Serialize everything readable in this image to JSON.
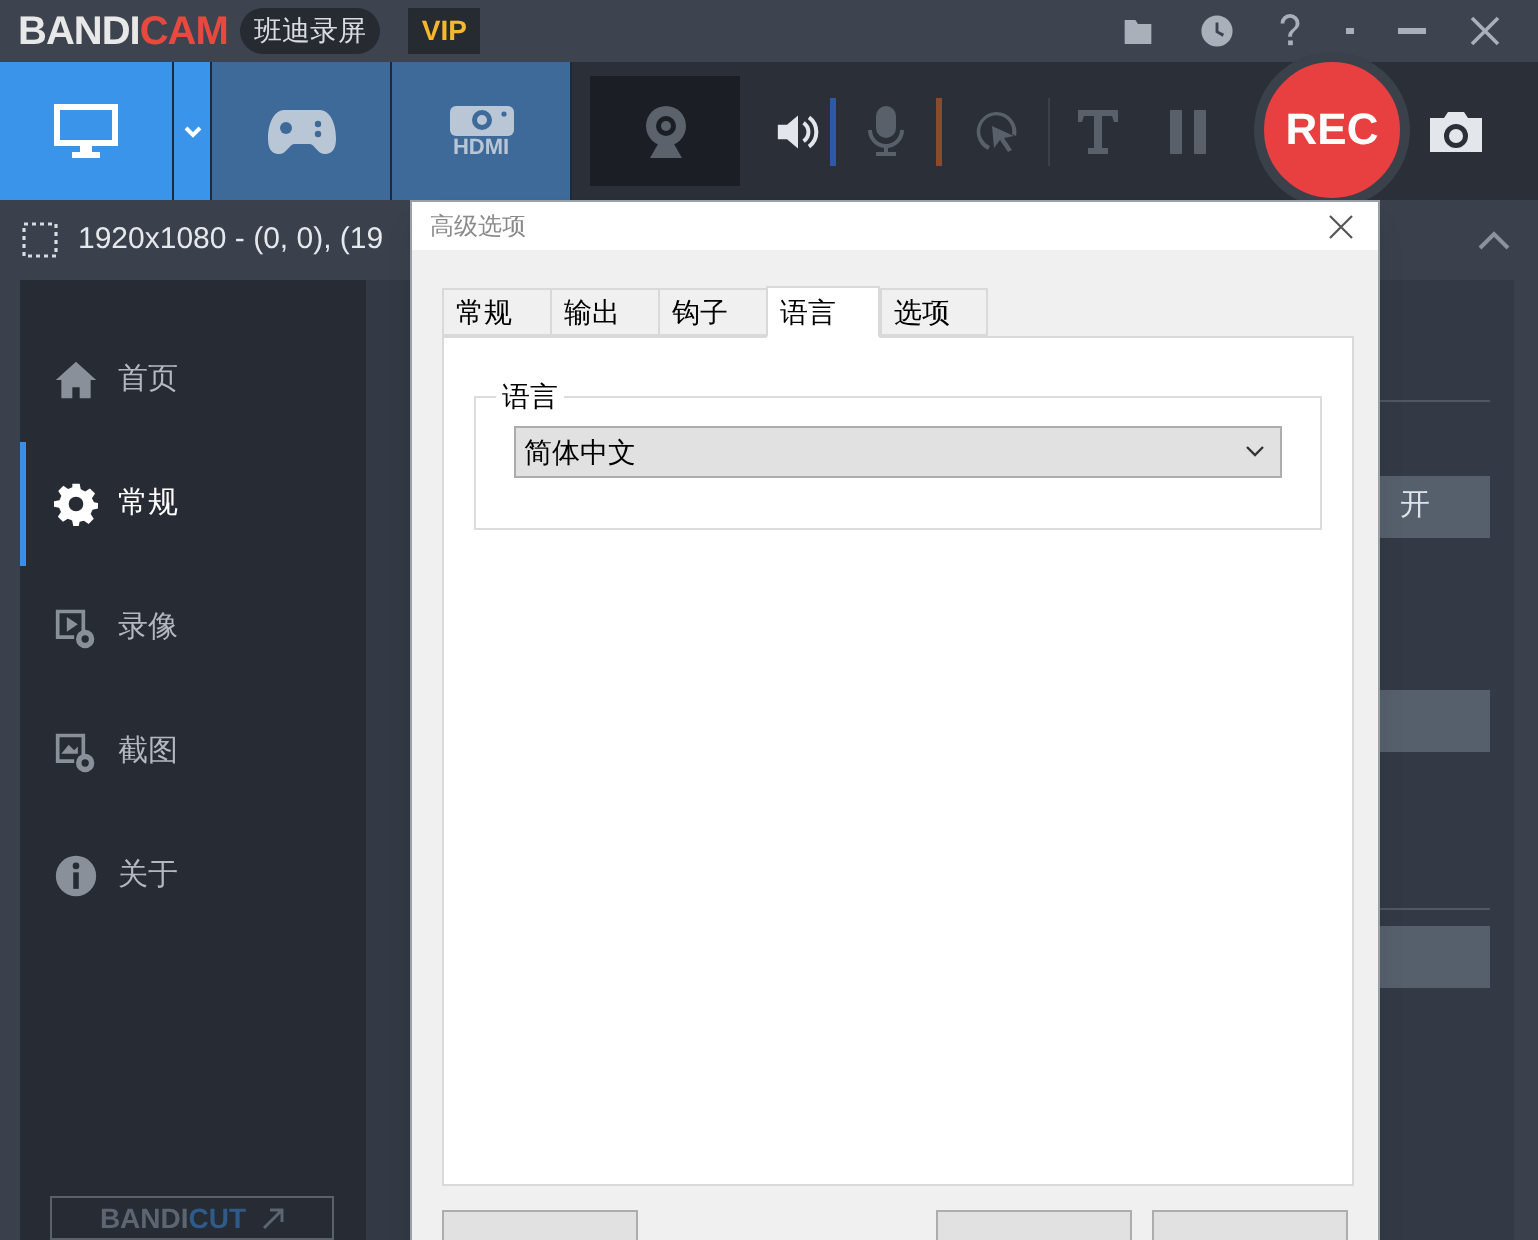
{
  "app": {
    "logo_main": "BANDI",
    "logo_accent": "CAM",
    "edition": "班迪录屏",
    "badge": "VIP"
  },
  "modes": [
    {
      "kind": "screen",
      "selected": true
    },
    {
      "kind": "game",
      "selected": false
    },
    {
      "kind": "hdmi",
      "caption": "HDMI",
      "selected": false
    }
  ],
  "rec_button": "REC",
  "region": "1920x1080 - (0, 0), (19",
  "sidebar": {
    "items": [
      {
        "kind": "home",
        "label": "首页",
        "selected": false
      },
      {
        "kind": "gear",
        "label": "常规",
        "selected": true
      },
      {
        "kind": "video",
        "label": "录像",
        "selected": false
      },
      {
        "kind": "image",
        "label": "截图",
        "selected": false
      },
      {
        "kind": "info",
        "label": "关于",
        "selected": false
      }
    ],
    "footer": {
      "main": "BANDI",
      "accent": "CUT"
    }
  },
  "background_panel": {
    "button_text": "开"
  },
  "dialog": {
    "title": "高级选项",
    "tabs": [
      {
        "label": "常规",
        "selected": false
      },
      {
        "label": "输出",
        "selected": false
      },
      {
        "label": "钩子",
        "selected": false
      },
      {
        "label": "语言",
        "selected": true
      },
      {
        "label": "选项",
        "selected": false
      }
    ],
    "group": {
      "label": "语言",
      "select": {
        "value": "简体中文"
      }
    }
  }
}
